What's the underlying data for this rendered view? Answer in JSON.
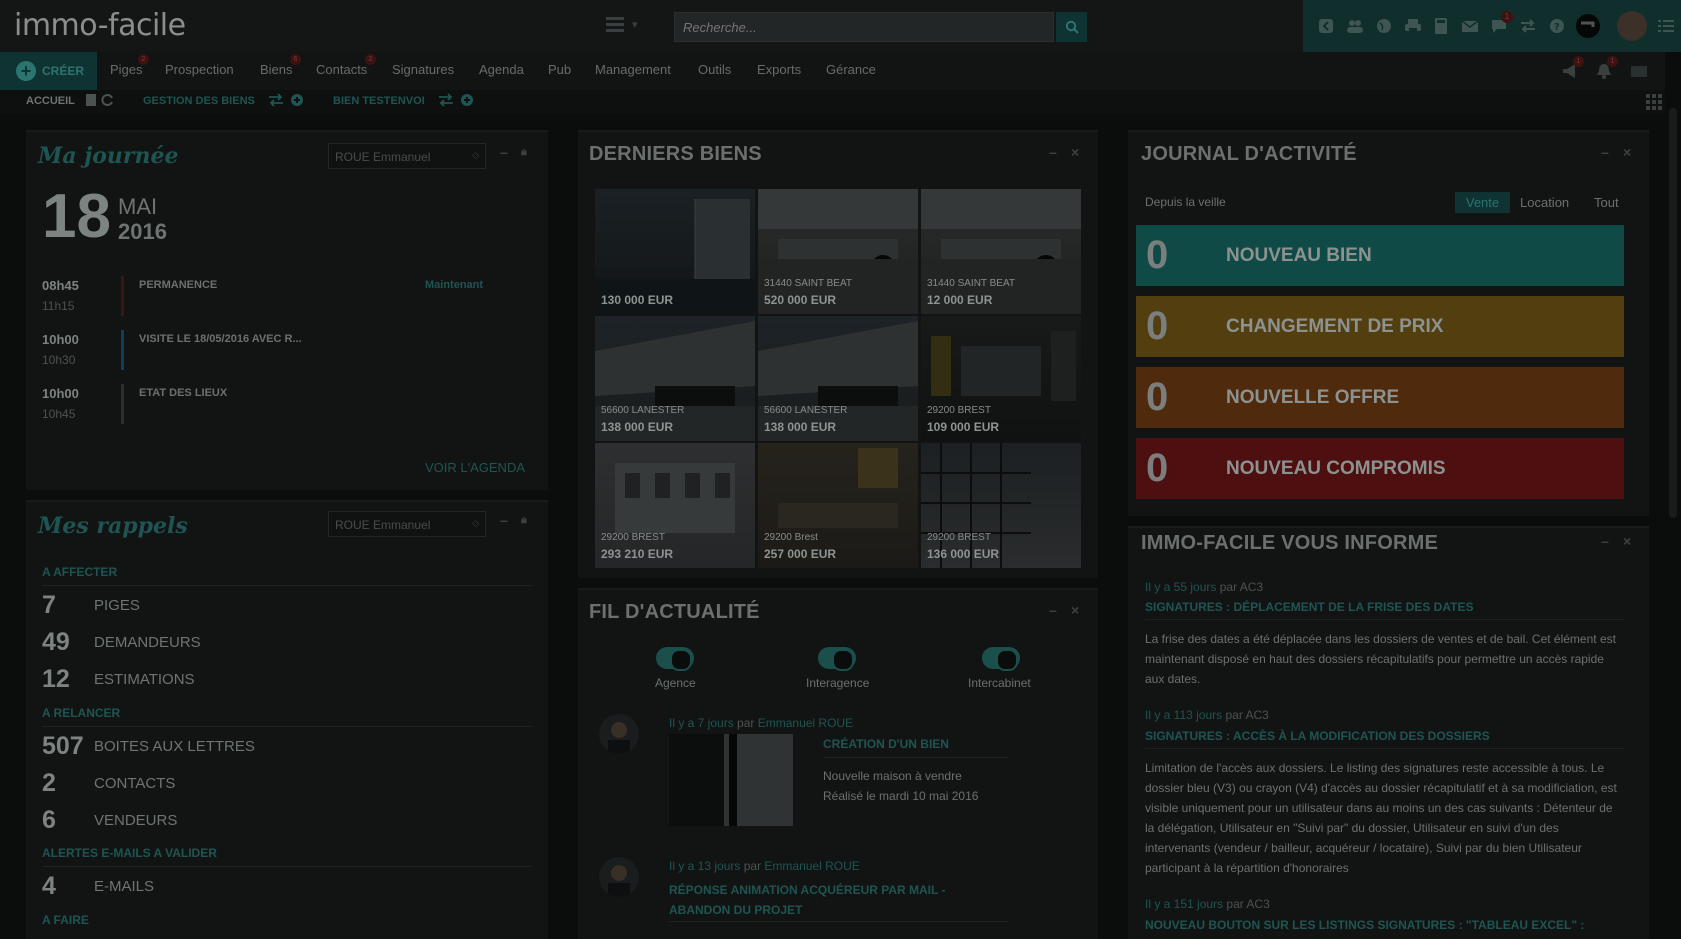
{
  "app": {
    "logo": "immo-facile"
  },
  "search": {
    "placeholder": "Recherche..."
  },
  "nav": {
    "create_label": "CRÉER",
    "items": [
      "Piges",
      "Prospection",
      "Biens",
      "Contacts",
      "Signatures",
      "Agenda",
      "Pub",
      "Management",
      "Outils",
      "Exports",
      "Gérance"
    ],
    "badges": {
      "piges": "2",
      "biens": "6",
      "contacts": "2"
    }
  },
  "topbar_badges": {
    "messages": "1",
    "alerts": "1",
    "bell": "1"
  },
  "breadcrumb": {
    "home": "ACCUEIL",
    "management": "GESTION DES BIENS",
    "property": "BIEN TESTENVOI"
  },
  "journee": {
    "title": "Ma journée",
    "user_select": "ROUE Emmanuel",
    "day": "18",
    "month": "MAI",
    "year": "2016",
    "events": [
      {
        "start": "08h45",
        "end": "11h15",
        "label": "PERMANENCE",
        "status": "Maintenant",
        "color": "#3d1514"
      },
      {
        "start": "10h00",
        "end": "10h30",
        "label": "VISITE LE 18/05/2016 AVEC R...",
        "status": "",
        "color": "#0f3f5c"
      },
      {
        "start": "10h00",
        "end": "10h45",
        "label": "ETAT DES LIEUX",
        "status": "",
        "color": "#2a2f2f"
      }
    ],
    "agenda_link": "VOIR L'AGENDA"
  },
  "rappels": {
    "title": "Mes rappels",
    "user_select": "ROUE Emmanuel",
    "sections": [
      {
        "title": "A AFFECTER",
        "items": [
          {
            "count": "7",
            "label": "PIGES"
          },
          {
            "count": "49",
            "label": "DEMANDEURS"
          },
          {
            "count": "12",
            "label": "ESTIMATIONS"
          }
        ]
      },
      {
        "title": "A RELANCER",
        "items": [
          {
            "count": "507",
            "label": "BOITES AUX LETTRES"
          },
          {
            "count": "2",
            "label": "CONTACTS"
          },
          {
            "count": "6",
            "label": "VENDEURS"
          }
        ]
      },
      {
        "title": "ALERTES E-MAILS A VALIDER",
        "items": [
          {
            "count": "4",
            "label": "E-MAILS"
          }
        ]
      },
      {
        "title": "A FAIRE",
        "items": []
      }
    ]
  },
  "biens": {
    "title": "DERNIERS BIENS",
    "tiles": [
      {
        "city": "",
        "price": "130 000 EUR"
      },
      {
        "city": "31440 SAINT BEAT",
        "price": "520 000 EUR"
      },
      {
        "city": "31440 SAINT BEAT",
        "price": "12 000 EUR"
      },
      {
        "city": "56600 LANESTER",
        "price": "138 000 EUR"
      },
      {
        "city": "56600 LANESTER",
        "price": "138 000 EUR"
      },
      {
        "city": "29200 BREST",
        "price": "109 000 EUR"
      },
      {
        "city": "29200 BREST",
        "price": "293 210 EUR"
      },
      {
        "city": "29200 Brest",
        "price": "257 000 EUR"
      },
      {
        "city": "29200 BREST",
        "price": "136 000 EUR"
      }
    ]
  },
  "fil": {
    "title": "FIL D'ACTUALITÉ",
    "toggles": [
      "Agence",
      "Interagence",
      "Intercabinet"
    ],
    "posts": [
      {
        "ago": "Il y a 7 jours",
        "par": "par",
        "author": "Emmanuel ROUE",
        "title": "CRÉATION D'UN BIEN",
        "line1": "Nouvelle maison à vendre",
        "line2": "Réalisé le mardi 10 mai 2016"
      },
      {
        "ago": "Il y a 13 jours",
        "par": "par",
        "author": "Emmanuel ROUE",
        "title": "RÉPONSE ANIMATION ACQUÉREUR PAR MAIL - ABANDON DU PROJET",
        "line1": "",
        "line2": ""
      }
    ]
  },
  "journal": {
    "title": "JOURNAL D'ACTIVITÉ",
    "since": "Depuis la veille",
    "tabs": [
      "Vente",
      "Location",
      "Tout"
    ],
    "kpis": [
      {
        "count": "0",
        "label": "NOUVEAU BIEN",
        "color": "#104a46"
      },
      {
        "count": "0",
        "label": "CHANGEMENT DE PRIX",
        "color": "#533e10"
      },
      {
        "count": "0",
        "label": "NOUVELLE OFFRE",
        "color": "#4f2a0d"
      },
      {
        "count": "0",
        "label": "NOUVEAU COMPROMIS",
        "color": "#4d0f0f"
      }
    ]
  },
  "informe": {
    "title": "IMMO-FACILE VOUS INFORME",
    "items": [
      {
        "ago": "Il y a 55 jours",
        "par": "par AC3",
        "title": "SIGNATURES : DÉPLACEMENT DE LA FRISE DES DATES",
        "body": "La frise des dates a été déplacée dans les dossiers de ventes et de bail. Cet élément est maintenant disposé en haut des dossiers récapitulatifs pour permettre un accès rapide aux dates."
      },
      {
        "ago": "Il y a 113 jours",
        "par": "par AC3",
        "title": "SIGNATURES : ACCÈS À LA MODIFICATION DES DOSSIERS",
        "body": "Limitation de l'accès aux dossiers. Le listing des signatures reste accessible à tous. Le dossier bleu (V3) ou crayon (V4) d'accès au dossier récapitulatif et à sa modificiation, est visible uniquement pour un utilisateur dans au moins un des cas suivants : Détenteur de la délégation, Utilisateur en \"Suivi par\" du dossier, Utilisateur en suivi d'un des intervenants (vendeur / bailleur, acquéreur / locataire), Suivi par du bien Utilisateur participant à la répartition d'honoraires"
      },
      {
        "ago": "Il y a 151 jours",
        "par": "par AC3",
        "title": "NOUVEAU BOUTON SUR LES LISTINGS SIGNATURES : \"TABLEAU EXCEL\" :",
        "body": ""
      }
    ]
  },
  "colors": {
    "accent": "#1e5552",
    "header_right": "#0f2e2c"
  }
}
